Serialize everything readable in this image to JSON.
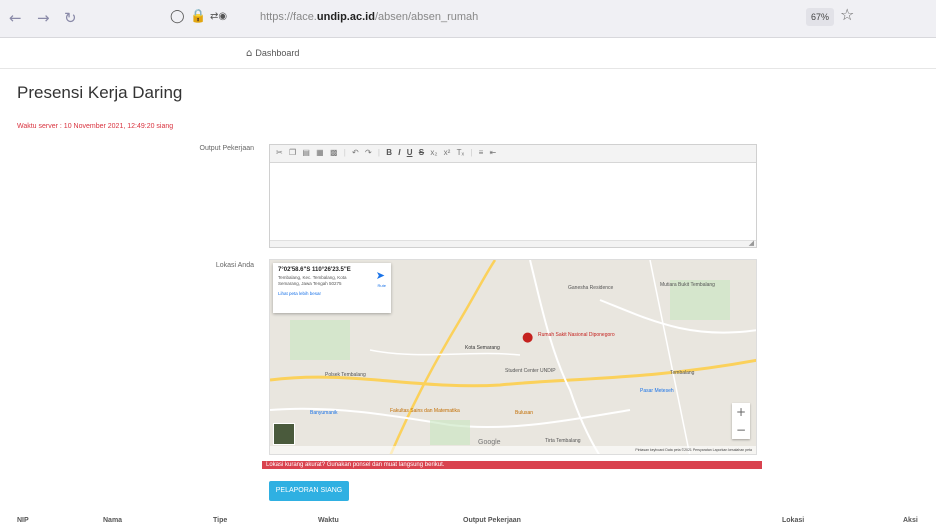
{
  "browser": {
    "url_prefix": "https://face.",
    "url_domain": "undip.ac.id",
    "url_path": "/absen/absen_rumah",
    "zoom": "67%"
  },
  "navbar": {
    "dashboard_label": "Dashboard"
  },
  "page": {
    "title": "Presensi Kerja Daring",
    "server_time": "Waktu server : 10 November 2021, 12:49:20 siang"
  },
  "form": {
    "output_label": "Output Pekerjaan",
    "location_label": "Lokasi Anda",
    "submit_label": "PELAPORAN SIANG",
    "alert_text": "Lokasi kurang akurat? Gunakan ponsel dan muat langsung berikut."
  },
  "map": {
    "coords": "7°02'58.6\"S 110°26'23.5\"E",
    "address": "Tembalang, Kec. Tembalang, Kota Semarang, Jawa Tengah 50275",
    "larger_map_link": "Lihat peta lebih besar",
    "route_label": "Rute",
    "places": [
      "Rumah Sakit Nasional Diponegoro",
      "Student Center UNDIP",
      "Pasar Meteseh",
      "Polsek Tembalang",
      "Tembalang",
      "Banyumanik",
      "Fakultas Sains dan Matematika",
      "Kota Semarang",
      "Bulusan",
      "Ganesha Residence",
      "Mutiara Bukit Tembalang",
      "Tirta Tembalang"
    ],
    "footer": "Pintasan keyboard   Data peta ©2021   Persyaratan   Laporkan kesalahan peta"
  },
  "table_headers": [
    "NIP",
    "Nama",
    "Tipe",
    "Waktu",
    "Output Pekerjaan",
    "Lokasi",
    "Aksi"
  ]
}
